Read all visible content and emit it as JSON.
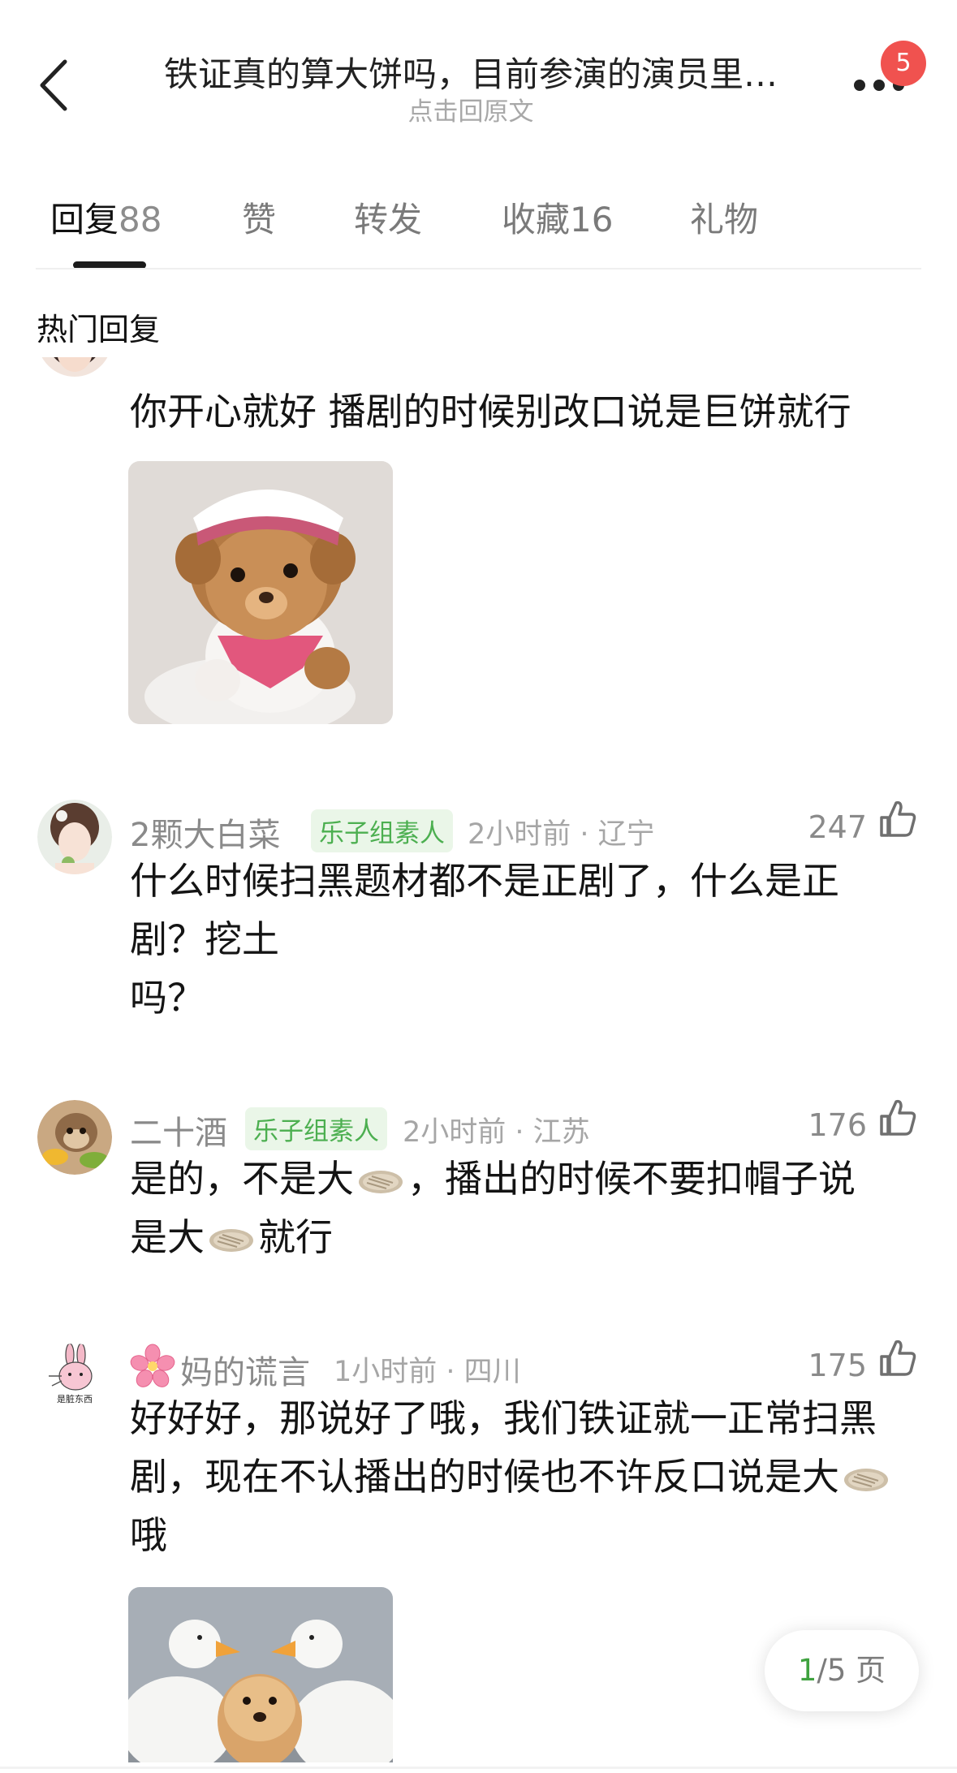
{
  "header": {
    "title": "铁证真的算大饼吗，目前参演的演员里…",
    "subtitle": "点击回原文",
    "notification_count": "5"
  },
  "tabs": [
    {
      "label": "回复",
      "count": "88",
      "active": true
    },
    {
      "label": "赞",
      "count": "",
      "active": false
    },
    {
      "label": "转发",
      "count": "",
      "active": false
    },
    {
      "label": "收藏",
      "count": "16",
      "active": false
    },
    {
      "label": "礼物",
      "count": "",
      "active": false
    }
  ],
  "section_title": "热门回复",
  "comments": [
    {
      "text": "你开心就好 播剧的时候别改口说是巨饼就行",
      "image": "teddy-bear-sticker"
    },
    {
      "username": "2颗大白菜",
      "tag": "乐子组素人",
      "time": "2小时前",
      "location": "辽宁",
      "likes": "247",
      "line1": "什么时候扫黑题材都不是正剧了，什么是正",
      "line2": "剧？挖土",
      "line3": "吗？"
    },
    {
      "username": "二十酒",
      "tag": "乐子组素人",
      "time": "2小时前",
      "location": "江苏",
      "likes": "176",
      "line1a": "是的，不是大",
      "line1b": "，播出的时候不要扣帽子说",
      "line2a": "是大",
      "line2b": "就行"
    },
    {
      "username": "妈的谎言",
      "time": "1小时前",
      "location": "四川",
      "likes": "175",
      "avatar_text": "是脏东西",
      "line1": "好好好，那说好了哦，我们铁证就一正常扫黑",
      "line2": "剧，现在不认播出的时候也不许反口说是大",
      "line3": "哦",
      "image": "dog-and-ducks-photo"
    }
  ],
  "pager": {
    "current": "1",
    "total_text": "/5 页"
  }
}
